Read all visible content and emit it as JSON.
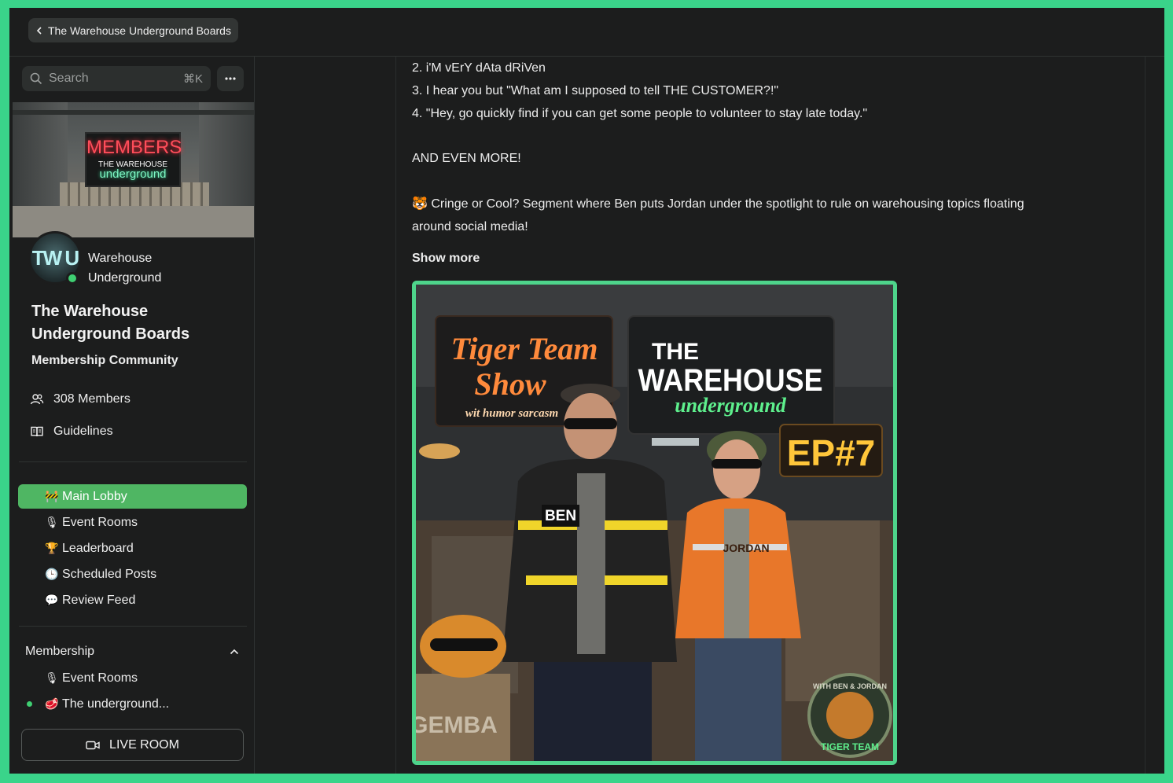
{
  "header": {
    "back_label": "The Warehouse Underground Boards"
  },
  "sidebar": {
    "search": {
      "placeholder": "Search",
      "shortcut": "⌘K"
    },
    "banner": {
      "sign_top": "MEMBERS",
      "sign_mid": "THE WAREHOUSE",
      "sign_bottom": "underground"
    },
    "logo_text": "TW U",
    "brand_name": "Warehouse Underground",
    "community_title": "The Warehouse Underground Boards",
    "community_subtitle": "Membership Community",
    "members_label": "308 Members",
    "guidelines_label": "Guidelines",
    "nav_items": [
      {
        "emoji": "🚧",
        "label": "Main Lobby",
        "active": true
      },
      {
        "emoji": "🎙",
        "label": "Event Rooms"
      },
      {
        "emoji": "🏆",
        "label": "Leaderboard"
      },
      {
        "emoji": "🕒",
        "label": "Scheduled Posts"
      },
      {
        "emoji": "💬",
        "label": "Review Feed"
      }
    ],
    "membership_section": {
      "title": "Membership",
      "items": [
        {
          "emoji": "🎙",
          "label": "Event Rooms"
        },
        {
          "emoji": "🥩",
          "label": "The underground...",
          "unread": true
        }
      ]
    },
    "live_room_label": "LIVE ROOM"
  },
  "post": {
    "lines": [
      "2. i'M vErY dAta dRiVen",
      "3. I hear you but \"What am I supposed to tell THE CUSTOMER?!\"",
      "4. \"Hey, go quickly find if you can get some people to volunteer to stay late today.\"",
      "AND EVEN MORE!",
      "🐯 Cringe or Cool? Segment where Ben puts Jordan under the spotlight to rule on warehousing topics floating",
      "around social media!"
    ],
    "show_more_label": "Show more",
    "artwork": {
      "sign_left_1": "Tiger Team",
      "sign_left_2": "Show",
      "sign_left_3": "wit humor sarcasm",
      "sign_right_1": "THE",
      "sign_right_2": "WAREHOUSE",
      "sign_right_3": "underground",
      "episode": "EP#7",
      "name_left": "BEN",
      "name_right": "JORDAN",
      "crate_label": "GEMBA",
      "badge_top": "WITH BEN & JORDAN",
      "badge_bottom": "TIGER TEAM"
    }
  },
  "colors": {
    "accent": "#4fb663",
    "frame": "#3ad48a",
    "background": "#1c1d1d"
  }
}
